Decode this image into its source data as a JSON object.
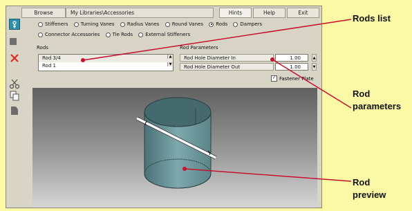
{
  "toolbar": {
    "browse": "Browse",
    "path": "My Libraries\\Accessories",
    "hints": "Hints",
    "help": "Help",
    "exit": "Exit"
  },
  "categories": [
    {
      "label": "Stiffeners",
      "selected": false
    },
    {
      "label": "Turning Vanes",
      "selected": false
    },
    {
      "label": "Radius Vanes",
      "selected": false
    },
    {
      "label": "Round Vanes",
      "selected": false
    },
    {
      "label": "Rods",
      "selected": true
    },
    {
      "label": "Dampers",
      "selected": false
    },
    {
      "label": "Connector Accessories",
      "selected": false
    },
    {
      "label": "Tie Rods",
      "selected": false
    },
    {
      "label": "External Stiffeners",
      "selected": false
    }
  ],
  "rods": {
    "heading": "Rods",
    "items": [
      "Rod 3/4",
      "Rod 1"
    ]
  },
  "params": {
    "heading": "Rod Parameters",
    "rows": [
      {
        "name": "Rod Hole Diameter In",
        "value": "1.00"
      },
      {
        "name": "Rod Hole Diameter Out",
        "value": "1.00"
      }
    ]
  },
  "fastener": {
    "label": "Fastener Plate",
    "checked": true
  },
  "callouts": {
    "rods_list": "Rods list",
    "rod_parameters_1": "Rod",
    "rod_parameters_2": "parameters",
    "rod_preview_1": "Rod",
    "rod_preview_2": "preview"
  },
  "colors": {
    "callout_bg": "#fbf8a6",
    "callout_line": "#c8102e"
  }
}
